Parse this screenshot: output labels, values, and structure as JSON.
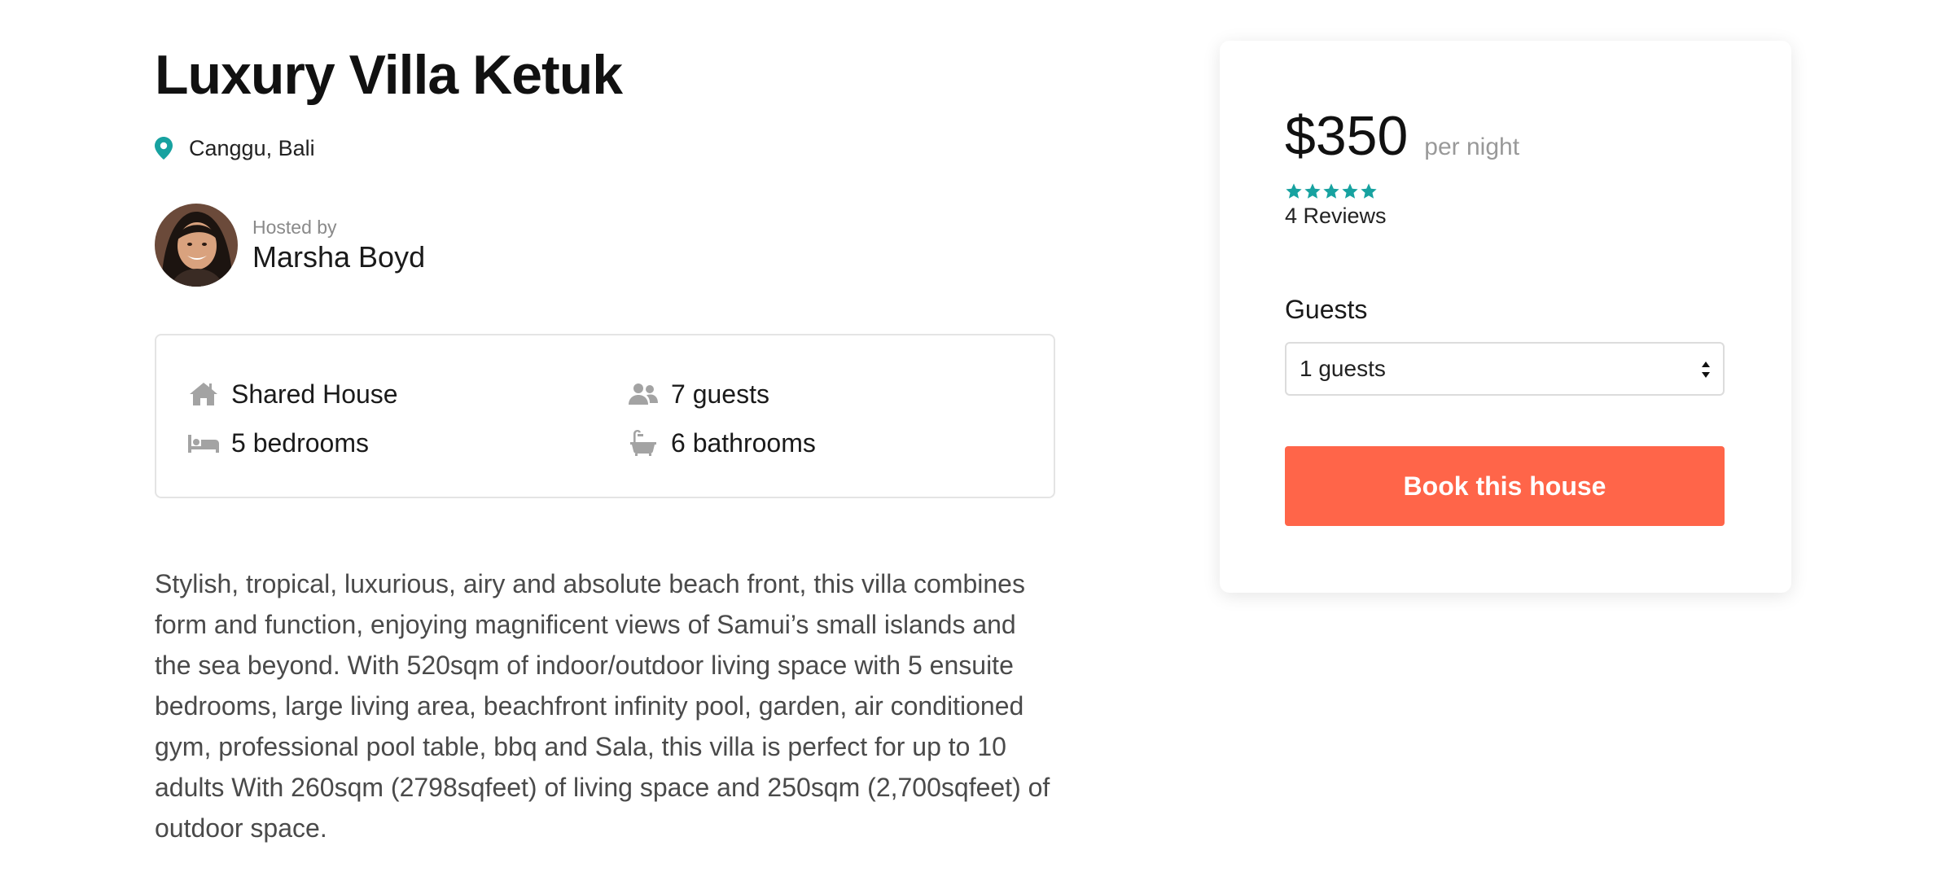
{
  "listing": {
    "title": "Luxury Villa Ketuk",
    "location": "Canggu, Bali",
    "host_label": "Hosted by",
    "host_name": "Marsha Boyd",
    "features": {
      "type": "Shared House",
      "guests": "7 guests",
      "bedrooms": "5 bedrooms",
      "bathrooms": "6 bathrooms"
    },
    "description": "Stylish, tropical, luxurious, airy and absolute beach front, this villa combines form and function, enjoying magnificent views of Samui’s small islands and the sea beyond. With 520sqm of indoor/outdoor living space with 5 ensuite bedrooms, large living area, beachfront infinity pool, garden, air conditioned gym, professional pool table, bbq and Sala, this villa is perfect for up to 10 adults With 260sqm (2798sqfeet) of living space and 250sqm (2,700sqfeet) of outdoor space."
  },
  "booking": {
    "price": "$350",
    "per_night": "per night",
    "rating": 5,
    "reviews": "4 Reviews",
    "guests_label": "Guests",
    "guests_selected": "1 guests",
    "book_label": "Book this house"
  },
  "colors": {
    "accent": "#ff6549",
    "teal": "#17a2a0",
    "icon_gray": "#a3a3a3"
  },
  "icons": {
    "location": "map-pin-icon",
    "house": "house-icon",
    "guests": "people-icon",
    "bedrooms": "bed-icon",
    "bathrooms": "bathtub-icon",
    "star": "star-icon"
  }
}
